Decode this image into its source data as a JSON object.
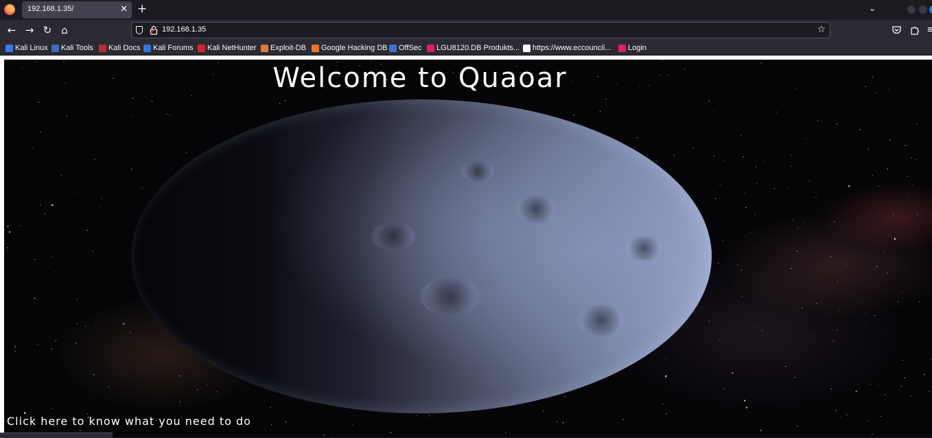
{
  "tab": {
    "title": "192.168.1.35/"
  },
  "url": {
    "address": "192.168.1.35"
  },
  "bookmarks": [
    {
      "label": "Kali Linux",
      "color": "#367bf0"
    },
    {
      "label": "Kali Tools",
      "color": "#3f6fc2"
    },
    {
      "label": "Kali Docs",
      "color": "#c02a2a"
    },
    {
      "label": "Kali Forums",
      "color": "#2d7bd8"
    },
    {
      "label": "Kali NetHunter",
      "color": "#d42626"
    },
    {
      "label": "Exploit-DB",
      "color": "#e8772e"
    },
    {
      "label": "Google Hacking DB",
      "color": "#e8772e"
    },
    {
      "label": "OffSec",
      "color": "#3c72d9"
    },
    {
      "label": "LGU8120.DB Produkts...",
      "color": "#e02060"
    },
    {
      "label": "https://www.eccouncil...",
      "color": "#fbfbfe"
    },
    {
      "label": "Login",
      "color": "#e02060"
    }
  ],
  "page": {
    "heading": "Welcome to Quaoar",
    "link_text": "Click here to know what you need to do"
  }
}
